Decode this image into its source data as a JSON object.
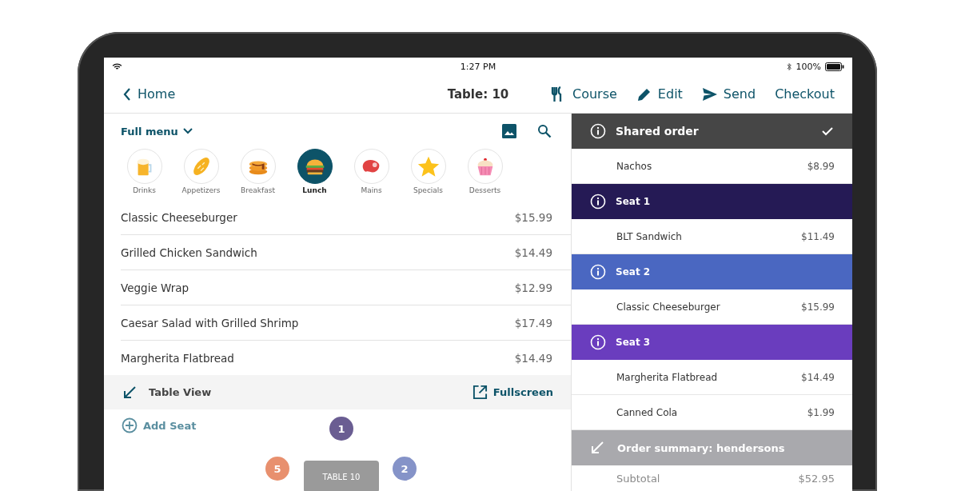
{
  "status_bar": {
    "time": "1:27 PM",
    "battery": "100%"
  },
  "nav": {
    "back": "Home",
    "title": "Table: 10",
    "actions": [
      {
        "kind": "course",
        "label": "Course"
      },
      {
        "kind": "edit",
        "label": "Edit"
      },
      {
        "kind": "send",
        "label": "Send"
      },
      {
        "kind": "plain",
        "label": "Checkout"
      }
    ]
  },
  "menu": {
    "selector": "Full menu",
    "categories": [
      {
        "kind": "drinks",
        "label": "Drinks",
        "selected": false
      },
      {
        "kind": "bread",
        "label": "Appetizers",
        "selected": false
      },
      {
        "kind": "pancakes",
        "label": "Breakfast",
        "selected": false
      },
      {
        "kind": "burger",
        "label": "Lunch",
        "selected": true
      },
      {
        "kind": "steak",
        "label": "Mains",
        "selected": false
      },
      {
        "kind": "star",
        "label": "Specials",
        "selected": false
      },
      {
        "kind": "cupcake",
        "label": "Desserts",
        "selected": false
      }
    ],
    "items": [
      {
        "name": "Classic Cheeseburger",
        "price": "$15.99"
      },
      {
        "name": "Grilled Chicken Sandwich",
        "price": "$14.49"
      },
      {
        "name": "Veggie Wrap",
        "price": "$12.99"
      },
      {
        "name": "Caesar Salad with Grilled Shrimp",
        "price": "$17.49"
      },
      {
        "name": "Margherita Flatbread",
        "price": "$14.49"
      }
    ]
  },
  "table_view": {
    "title": "Table View",
    "fullscreen": "Fullscreen",
    "add_seat": "Add Seat",
    "table_label": "TABLE 10",
    "seats": [
      {
        "number": "1",
        "color": "#6a5d92"
      },
      {
        "number": "5",
        "color": "#e8906e"
      },
      {
        "number": "2",
        "color": "#8593c8"
      }
    ]
  },
  "order": {
    "groups": [
      {
        "title": "Shared order",
        "color": "#464646",
        "confirmed": true,
        "items": [
          {
            "name": "Nachos",
            "price": "$8.99"
          }
        ]
      },
      {
        "title": "Seat 1",
        "color": "#251a55",
        "confirmed": false,
        "items": [
          {
            "name": "BLT Sandwich",
            "price": "$11.49"
          }
        ]
      },
      {
        "title": "Seat 2",
        "color": "#4a67c1",
        "confirmed": false,
        "items": [
          {
            "name": "Classic Cheeseburger",
            "price": "$15.99"
          }
        ]
      },
      {
        "title": "Seat 3",
        "color": "#6a3dbe",
        "confirmed": false,
        "items": [
          {
            "name": "Margherita Flatbread",
            "price": "$14.49"
          },
          {
            "name": "Canned Cola",
            "price": "$1.99"
          }
        ]
      }
    ],
    "summary": {
      "title": "Order summary: hendersons",
      "rows": [
        {
          "label": "Subtotal",
          "value": "$52.95"
        }
      ]
    }
  }
}
